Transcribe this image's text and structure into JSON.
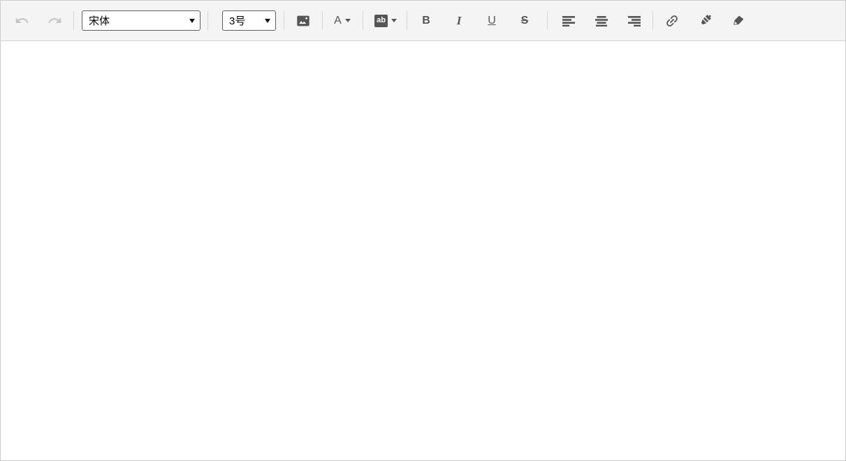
{
  "toolbar": {
    "font_family_select": {
      "value": "宋体"
    },
    "font_size_select": {
      "value": "3号"
    },
    "font_color_button": {
      "label": "A"
    },
    "background_color_button": {
      "label": "ab"
    },
    "bold_button": {
      "label": "B"
    },
    "italic_button": {
      "label": "I"
    },
    "underline_button": {
      "label": "U"
    },
    "strikethrough_button": {
      "label": "S"
    },
    "icons": [
      "undo-icon",
      "redo-icon",
      "image-icon",
      "chevron-down-icon",
      "align-left-icon",
      "align-center-icon",
      "align-right-icon",
      "link-icon",
      "brush-icon",
      "eraser-icon"
    ]
  },
  "content": {
    "text": ""
  },
  "colors": {
    "toolbar_bg": "#f4f4f4",
    "outer_border": "#cbcbcb",
    "toolbar_bottom_border": "#ccd3dc",
    "icon": "#555555",
    "disabled_icon": "#c6c6c6",
    "separator": "#d7d7d7",
    "select_border": "#5f5f5f"
  }
}
